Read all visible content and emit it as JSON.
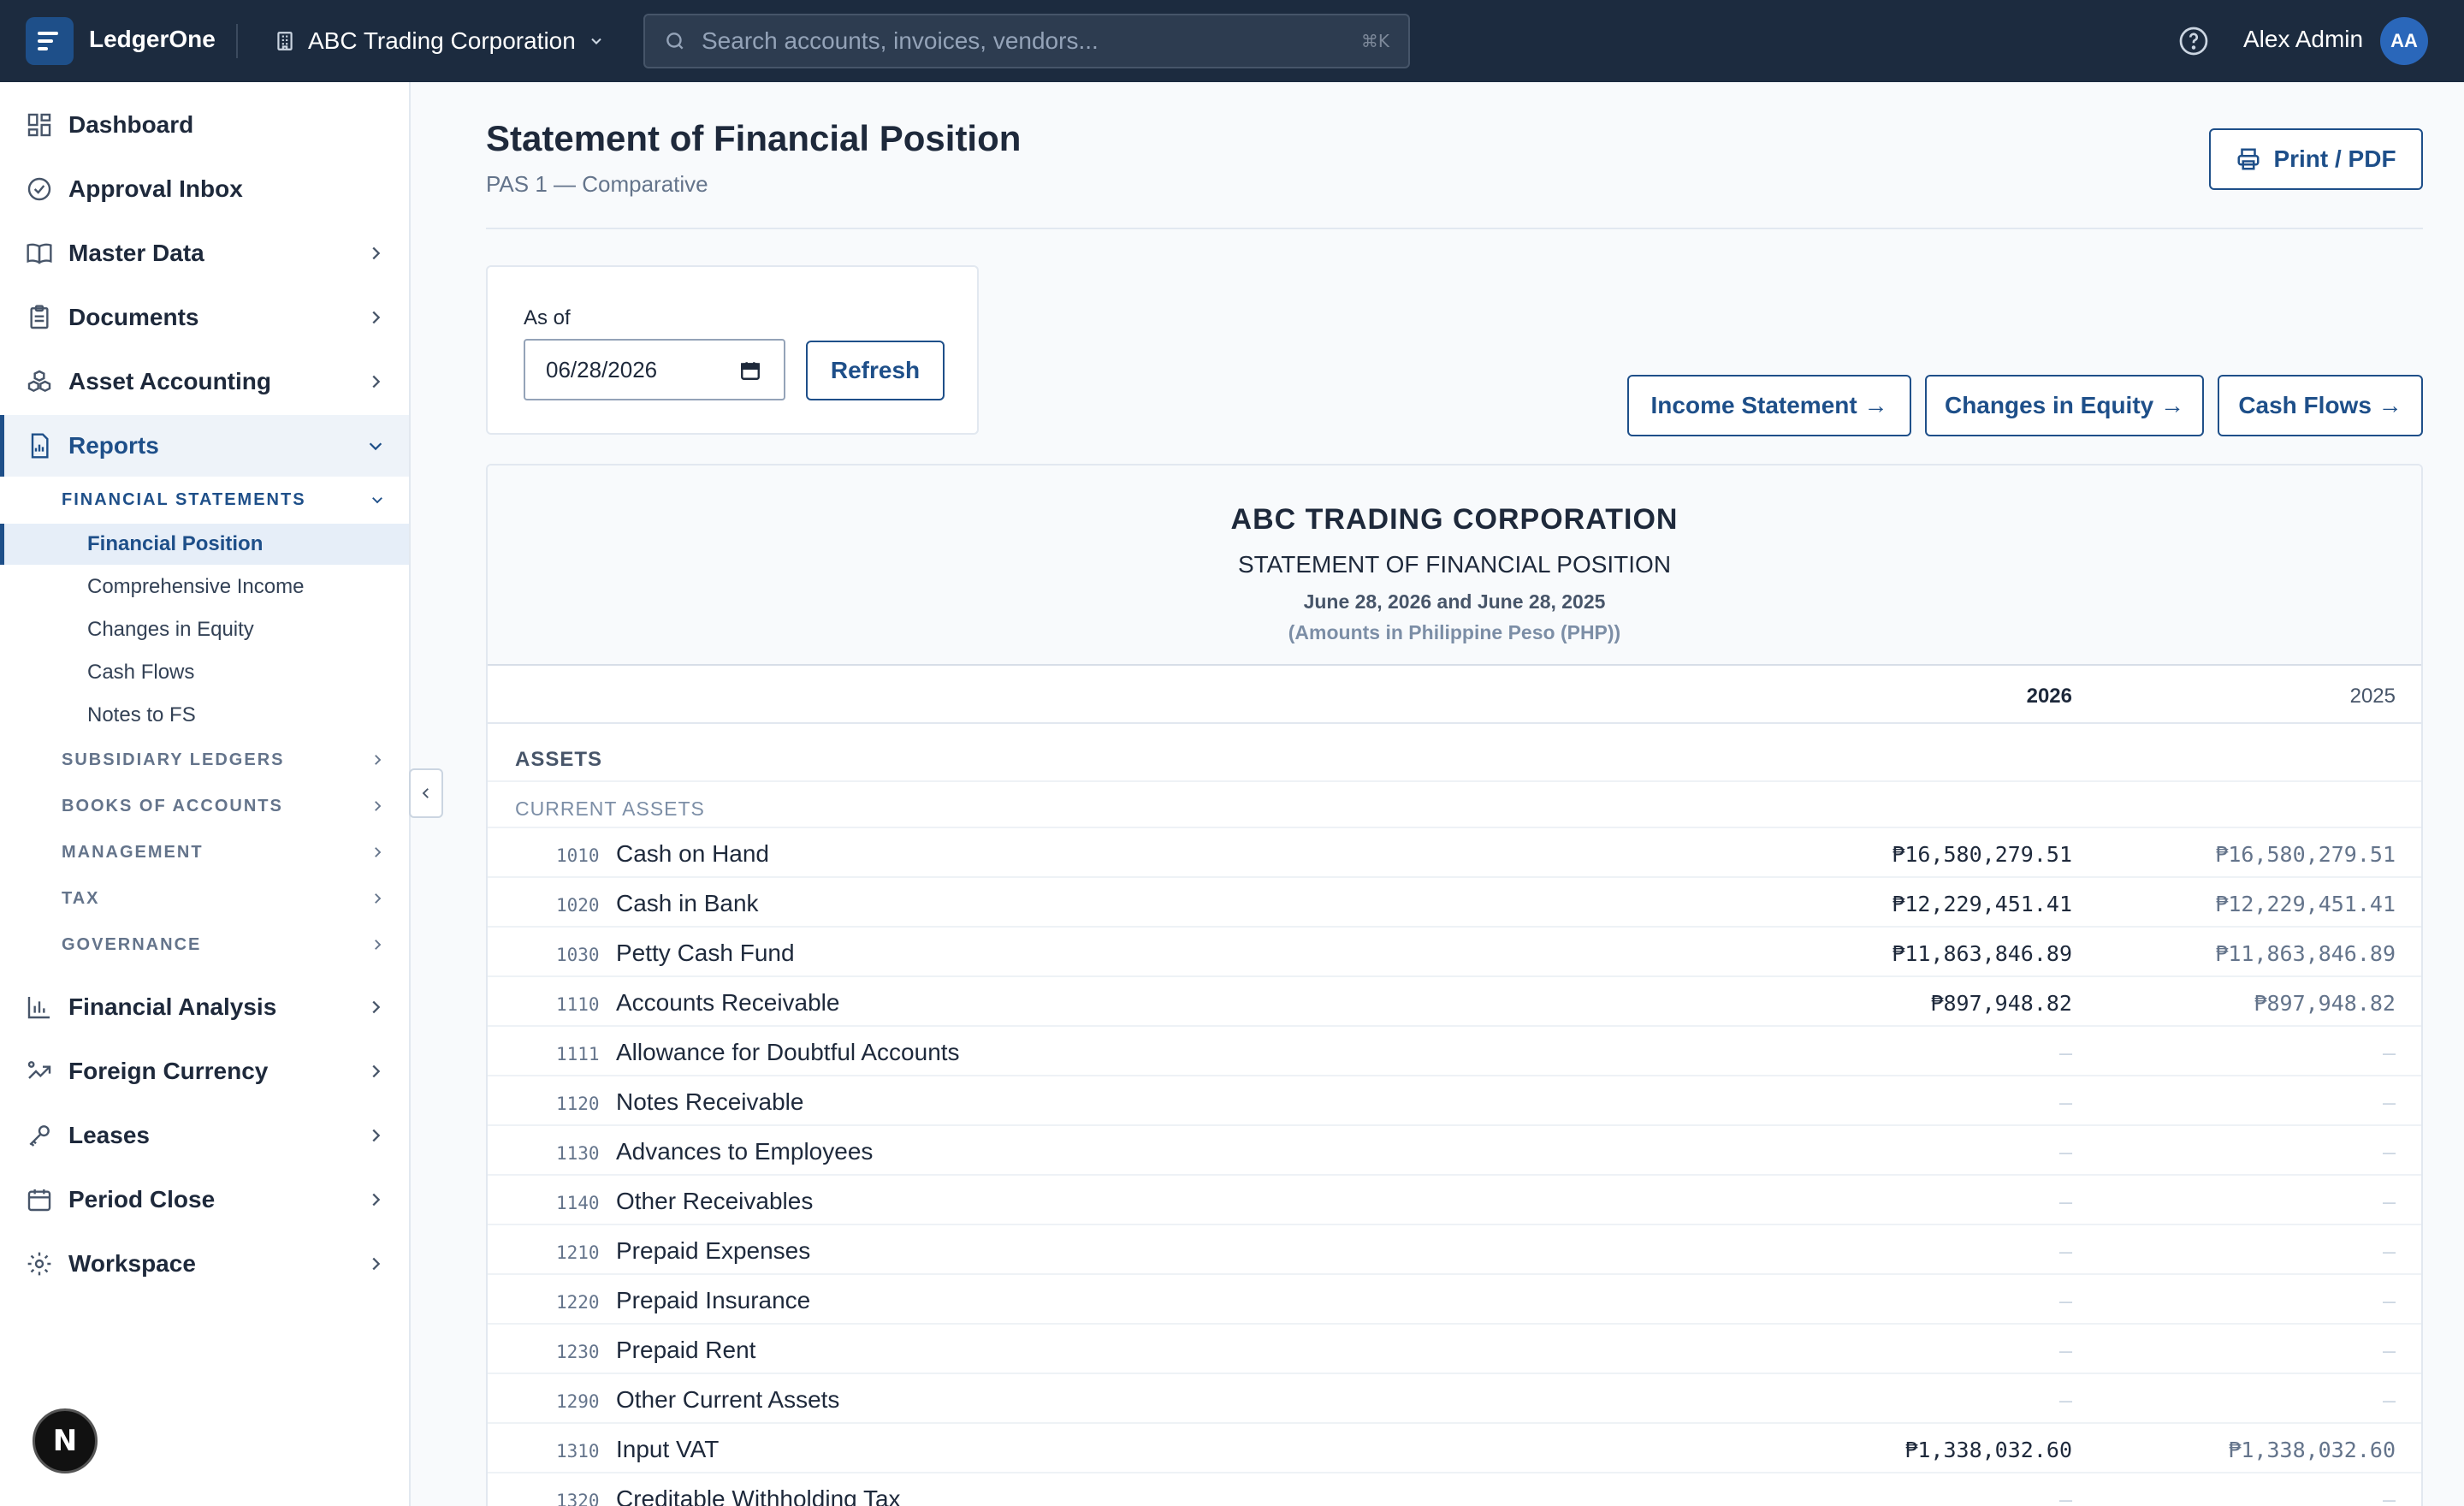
{
  "app": {
    "brand": "LedgerOne"
  },
  "topbar": {
    "company": "ABC Trading Corporation",
    "search_placeholder": "Search accounts, invoices, vendors...",
    "search_shortcut": "⌘K",
    "user_name": "Alex Admin",
    "user_initials": "AA"
  },
  "sidebar": {
    "items": [
      {
        "label": "Dashboard"
      },
      {
        "label": "Approval Inbox"
      },
      {
        "label": "Master Data"
      },
      {
        "label": "Documents"
      },
      {
        "label": "Asset Accounting"
      },
      {
        "label": "Reports"
      },
      {
        "label": "Financial Analysis"
      },
      {
        "label": "Foreign Currency"
      },
      {
        "label": "Leases"
      },
      {
        "label": "Period Close"
      },
      {
        "label": "Workspace"
      }
    ],
    "report_groups": [
      "FINANCIAL STATEMENTS",
      "SUBSIDIARY LEDGERS",
      "BOOKS OF ACCOUNTS",
      "MANAGEMENT",
      "TAX",
      "GOVERNANCE"
    ],
    "fs_items": [
      "Financial Position",
      "Comprehensive Income",
      "Changes in Equity",
      "Cash Flows",
      "Notes to FS"
    ],
    "badge": "N"
  },
  "page": {
    "title": "Statement of Financial Position",
    "subtitle": "PAS 1 — Comparative",
    "print_label": "Print / PDF",
    "as_of_label": "As of",
    "as_of_value": "06/28/2026",
    "refresh_label": "Refresh",
    "links": [
      "Income Statement →",
      "Changes in Equity →",
      "Cash Flows →"
    ]
  },
  "report": {
    "company": "ABC TRADING CORPORATION",
    "title": "STATEMENT OF FINANCIAL POSITION",
    "dates": "June 28, 2026 and June 28, 2025",
    "unit": "(Amounts in Philippine Peso (PHP))",
    "col_current": "2026",
    "col_prior": "2025",
    "section": "ASSETS",
    "subsection": "CURRENT ASSETS",
    "rows": [
      {
        "code": "1010",
        "name": "Cash on Hand",
        "v2026": "₱16,580,279.51",
        "v2025": "₱16,580,279.51"
      },
      {
        "code": "1020",
        "name": "Cash in Bank",
        "v2026": "₱12,229,451.41",
        "v2025": "₱12,229,451.41"
      },
      {
        "code": "1030",
        "name": "Petty Cash Fund",
        "v2026": "₱11,863,846.89",
        "v2025": "₱11,863,846.89"
      },
      {
        "code": "1110",
        "name": "Accounts Receivable",
        "v2026": "₱897,948.82",
        "v2025": "₱897,948.82"
      },
      {
        "code": "1111",
        "name": "Allowance for Doubtful Accounts",
        "v2026": "–",
        "v2025": "–"
      },
      {
        "code": "1120",
        "name": "Notes Receivable",
        "v2026": "–",
        "v2025": "–"
      },
      {
        "code": "1130",
        "name": "Advances to Employees",
        "v2026": "–",
        "v2025": "–"
      },
      {
        "code": "1140",
        "name": "Other Receivables",
        "v2026": "–",
        "v2025": "–"
      },
      {
        "code": "1210",
        "name": "Prepaid Expenses",
        "v2026": "–",
        "v2025": "–"
      },
      {
        "code": "1220",
        "name": "Prepaid Insurance",
        "v2026": "–",
        "v2025": "–"
      },
      {
        "code": "1230",
        "name": "Prepaid Rent",
        "v2026": "–",
        "v2025": "–"
      },
      {
        "code": "1290",
        "name": "Other Current Assets",
        "v2026": "–",
        "v2025": "–"
      },
      {
        "code": "1310",
        "name": "Input VAT",
        "v2026": "₱1,338,032.60",
        "v2025": "₱1,338,032.60"
      },
      {
        "code": "1320",
        "name": "Creditable Withholding Tax",
        "v2026": "–",
        "v2025": "–"
      }
    ]
  }
}
